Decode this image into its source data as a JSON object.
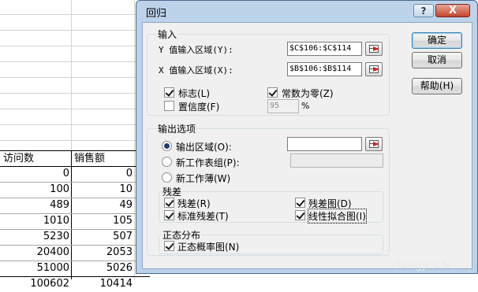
{
  "sheet": {
    "headers": [
      "访问数",
      "销售额"
    ],
    "rows": [
      [
        "0",
        "0"
      ],
      [
        "100",
        "10"
      ],
      [
        "489",
        "49"
      ],
      [
        "1010",
        "105"
      ],
      [
        "5230",
        "507"
      ],
      [
        "20400",
        "2053"
      ],
      [
        "51000",
        "5026"
      ],
      [
        "100602",
        "10414"
      ]
    ]
  },
  "dialog": {
    "title": "回归",
    "help_glyph": "?",
    "close_glyph": "X",
    "input_group": {
      "label": "输入",
      "y_label": "Y 值输入区域(Y):",
      "y_value": "$C$106:$C$114",
      "x_label": "X 值输入区域(X):",
      "x_value": "$B$106:$B$114",
      "labels_label": "标志(L)",
      "constant_zero_label": "常数为零(Z)",
      "confidence_label": "置信度(F)",
      "confidence_value": "95",
      "percent": "%"
    },
    "output_group": {
      "label": "输出选项",
      "output_range_label": "输出区域(O):",
      "output_range_value": "",
      "new_sheet_label": "新工作表组(P):",
      "new_sheet_value": "",
      "new_workbook_label": "新工作薄(W)"
    },
    "residuals_group": {
      "label": "残差",
      "residuals_label": "残差(R)",
      "standardized_label": "标准残差(T)",
      "residual_plots_label": "残差图(D)",
      "line_fit_label": "线性拟合图(I)"
    },
    "normal_group": {
      "label": "正态分布",
      "probability_label": "正态概率图(N)"
    },
    "buttons": {
      "ok": "确定",
      "cancel": "取消",
      "help": "帮助(H)"
    }
  },
  "watermark": "iTongji.CN"
}
